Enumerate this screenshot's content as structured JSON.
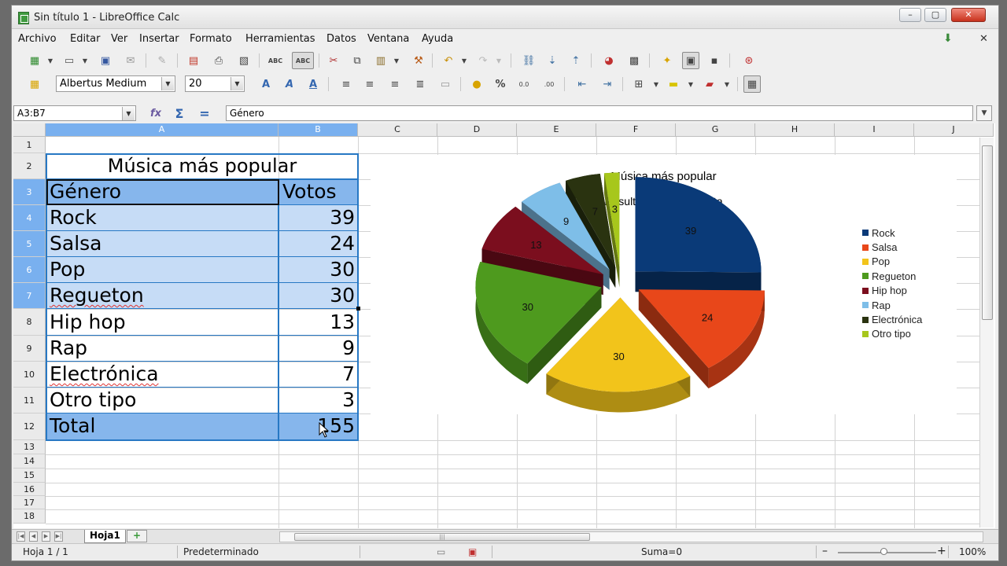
{
  "window": {
    "title": "Sin título 1 - LibreOffice Calc",
    "buttons": [
      "–",
      "▢",
      "✕"
    ]
  },
  "menu": {
    "items": [
      "Archivo",
      "Editar",
      "Ver",
      "Insertar",
      "Formato",
      "Herramientas",
      "Datos",
      "Ventana",
      "Ayuda"
    ],
    "close_label": "✕"
  },
  "format_bar": {
    "font_name": "Albertus Medium",
    "font_size": "20"
  },
  "formula_bar": {
    "name_box": "A3:B7",
    "function_wizard_icon": "fx",
    "sum_label": "Σ",
    "equals_label": "=",
    "content": "Género"
  },
  "sheet": {
    "columns": [
      "A",
      "B",
      "C",
      "D",
      "E",
      "F",
      "G",
      "H",
      "I",
      "J"
    ],
    "rows": [
      "1",
      "2",
      "3",
      "4",
      "5",
      "6",
      "7",
      "8",
      "9",
      "10",
      "11",
      "12",
      "13",
      "14",
      "15",
      "16",
      "17",
      "18"
    ],
    "title": "Música más popular",
    "header": [
      "Género",
      "Votos"
    ],
    "data": [
      {
        "genre": "Rock",
        "votes": "39"
      },
      {
        "genre": "Salsa",
        "votes": "24"
      },
      {
        "genre": "Pop",
        "votes": "30"
      },
      {
        "genre": "Regueton",
        "votes": "30"
      },
      {
        "genre": "Hip hop",
        "votes": "13"
      },
      {
        "genre": "Rap",
        "votes": "9"
      },
      {
        "genre": "Electrónica",
        "votes": "7"
      },
      {
        "genre": "Otro tipo",
        "votes": "3"
      }
    ],
    "total_label": "Total",
    "total_value": "155"
  },
  "chart_data": {
    "type": "pie",
    "title": "Música más popular",
    "subtitle": "Resultados de encuesta",
    "legend_position": "right",
    "categories": [
      "Rock",
      "Salsa",
      "Pop",
      "Regueton",
      "Hip hop",
      "Rap",
      "Electrónica",
      "Otro tipo"
    ],
    "values": [
      39,
      24,
      30,
      30,
      13,
      9,
      7,
      3
    ],
    "colors": [
      "#0a3a78",
      "#e8471a",
      "#f2c41b",
      "#4e9a1e",
      "#7b0e1e",
      "#7ebee8",
      "#2a3310",
      "#a7c71c"
    ]
  },
  "tabs": {
    "sheet_name": "Hoja1",
    "add_label": "+"
  },
  "status": {
    "sheet": "Hoja 1 / 1",
    "style": "Predeterminado",
    "sum": "Suma=0",
    "zoom": "100%"
  }
}
